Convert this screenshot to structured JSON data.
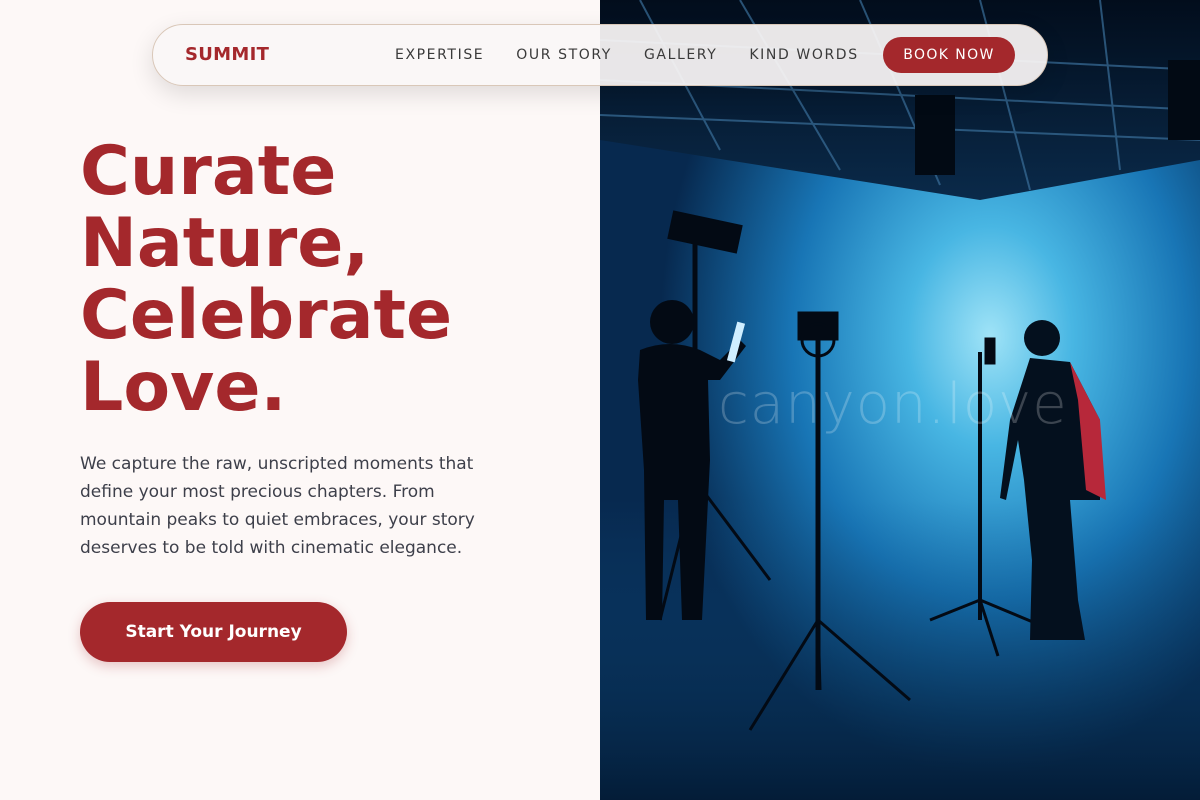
{
  "brand": "SUMMIT",
  "nav": {
    "links": [
      "EXPERTISE",
      "OUR STORY",
      "GALLERY",
      "KIND WORDS"
    ],
    "cta_label": "BOOK NOW"
  },
  "hero": {
    "headline_lines": [
      "Curate",
      "Nature,",
      "Celebrate",
      "Love."
    ],
    "description": "We capture the raw, unscripted moments that define your most precious chapters. From mountain peaks to quiet embraces, your story deserves to be told with cinematic elegance.",
    "cta_label": "Start Your Journey"
  },
  "image": {
    "watermark": "canyon.love"
  },
  "colors": {
    "accent": "#a4282c",
    "background": "#fdf8f7",
    "text": "#3d3f4a"
  }
}
